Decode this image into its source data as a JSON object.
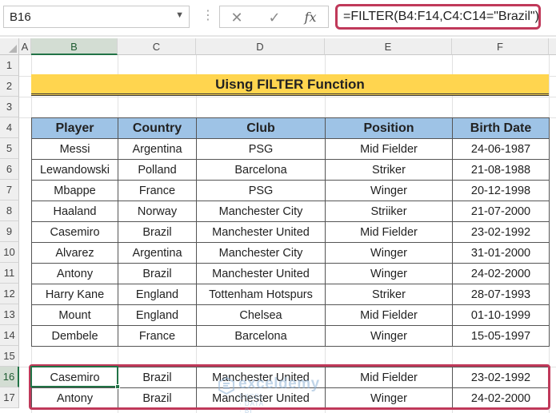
{
  "name_box": {
    "value": "B16"
  },
  "formula_bar": {
    "cancel_icon": "close-icon",
    "enter_icon": "check-icon",
    "function_label": "fx",
    "formula": "=FILTER(B4:F14,C4:C14=\"Brazil\")",
    "highlight_color": "#c0395a"
  },
  "columns": [
    "A",
    "B",
    "C",
    "D",
    "E",
    "F"
  ],
  "rows": [
    "1",
    "2",
    "3",
    "4",
    "5",
    "6",
    "7",
    "8",
    "9",
    "10",
    "11",
    "12",
    "13",
    "14",
    "15",
    "16",
    "17"
  ],
  "title": "Uisng FILTER Function",
  "table": {
    "headers": [
      "Player",
      "Country",
      "Club",
      "Position",
      "Birth Date"
    ],
    "rows": [
      [
        "Messi",
        "Argentina",
        "PSG",
        "Mid Fielder",
        "24-06-1987"
      ],
      [
        "Lewandowski",
        "Polland",
        "Barcelona",
        "Striker",
        "21-08-1988"
      ],
      [
        "Mbappe",
        "France",
        "PSG",
        "Winger",
        "20-12-1998"
      ],
      [
        "Haaland",
        "Norway",
        "Manchester City",
        "Striiker",
        "21-07-2000"
      ],
      [
        "Casemiro",
        "Brazil",
        "Manchester United",
        "Mid Fielder",
        "23-02-1992"
      ],
      [
        "Alvarez",
        "Argentina",
        "Manchester City",
        "Winger",
        "31-01-2000"
      ],
      [
        "Antony",
        "Brazil",
        "Manchester United",
        "Winger",
        "24-02-2000"
      ],
      [
        "Harry Kane",
        "England",
        "Tottenham Hotspurs",
        "Striker",
        "28-07-1993"
      ],
      [
        "Mount",
        "England",
        "Chelsea",
        "Mid Fielder",
        "01-10-1999"
      ],
      [
        "Dembele",
        "France",
        "Barcelona",
        "Winger",
        "15-05-1997"
      ]
    ]
  },
  "result": {
    "rows": [
      [
        "Casemiro",
        "Brazil",
        "Manchester United",
        "Mid Fielder",
        "23-02-1992"
      ],
      [
        "Antony",
        "Brazil",
        "Manchester United",
        "Winger",
        "24-02-2000"
      ]
    ]
  },
  "watermark": {
    "name": "exceldemy",
    "tagline": "EXCEL · DATA · BI"
  },
  "colors": {
    "header_fill": "#9ec3e6",
    "title_fill": "#ffd54f",
    "selection": "#217346"
  }
}
